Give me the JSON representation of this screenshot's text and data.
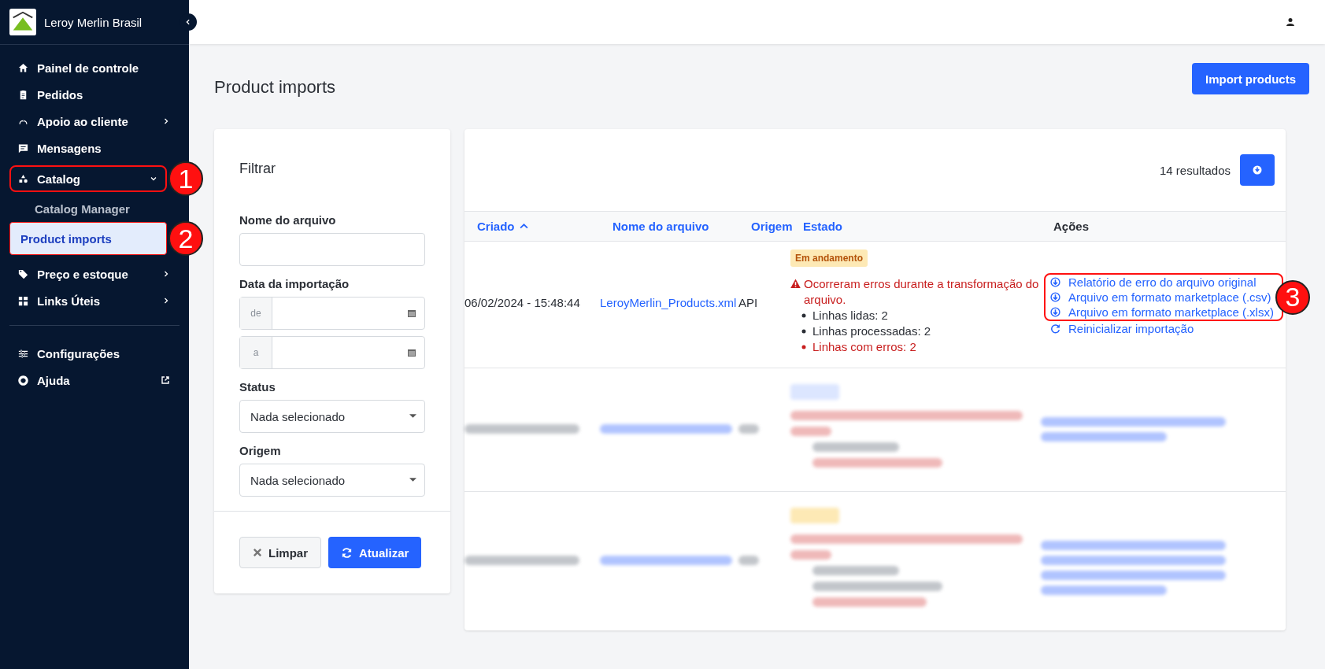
{
  "sidebar": {
    "brand": "Leroy Merlin Brasil",
    "sections": [
      [
        {
          "label": "Painel de controle"
        },
        {
          "label": "Pedidos"
        },
        {
          "label": "Apoio ao cliente",
          "expanded": false
        },
        {
          "label": "Mensagens"
        },
        {
          "label": "Catalog",
          "expanded": true,
          "callout": "1",
          "children": [
            {
              "label": "Catalog Manager",
              "selected": false
            },
            {
              "label": "Product imports",
              "selected": true,
              "callout": "2"
            }
          ]
        },
        {
          "label": "Preço e estoque",
          "expanded": false
        },
        {
          "label": "Links Úteis",
          "expanded": false
        }
      ],
      [
        {
          "label": "Configurações"
        },
        {
          "label": "Ajuda",
          "external": true
        }
      ]
    ]
  },
  "page": {
    "title": "Product imports",
    "import_button": "Import products"
  },
  "filter": {
    "title": "Filtrar",
    "file_label": "Nome do arquivo",
    "date_label": "Data da importação",
    "date_from": "de",
    "date_to": "a",
    "status_label": "Status",
    "status_value": "Nada selecionado",
    "origin_label": "Origem",
    "origin_value": "Nada selecionado",
    "clear_button": "Limpar",
    "refresh_button": "Atualizar"
  },
  "table": {
    "results": "14 resultados",
    "columns": [
      {
        "label": "Criado",
        "sorted": true,
        "link": true
      },
      {
        "label": "Nome do arquivo",
        "link": true
      },
      {
        "label": "Origem",
        "link": true
      },
      {
        "label": "Estado",
        "link": true
      },
      {
        "label": "Ações",
        "link": false
      }
    ],
    "rows": [
      {
        "blurred": false,
        "created": "06/02/2024 - 15:48:44",
        "file": "LeroyMerlin_Products.xml",
        "origin": "API",
        "status": {
          "label": "Em andamento",
          "kind": "progress"
        },
        "error": "Ocorreram erros durante a transformação do arquivo.",
        "lines": [
          {
            "text": "Linhas lidas: 2",
            "error": false
          },
          {
            "text": "Linhas processadas: 2",
            "error": false
          },
          {
            "text": "Linhas com erros: 2",
            "error": true
          }
        ],
        "callout": "3",
        "actions": [
          {
            "kind": "download",
            "label": "Relatório de erro do arquivo original",
            "in_callout": true
          },
          {
            "kind": "download",
            "label": "Arquivo em formato marketplace (.csv)",
            "in_callout": true
          },
          {
            "kind": "download",
            "label": "Arquivo em formato marketplace (.xlsx)",
            "in_callout": true
          },
          {
            "kind": "restart",
            "label": "Reinicializar importação",
            "in_callout": false
          }
        ]
      },
      {
        "blurred": true,
        "status": {
          "kind": "done"
        },
        "lines": [
          {
            "error": false
          },
          {
            "error": true
          }
        ],
        "actions": [
          {
            "kind": "download"
          },
          {
            "kind": "restart"
          }
        ]
      },
      {
        "blurred": true,
        "status": {
          "kind": "progress"
        },
        "lines": [
          {
            "error": false
          },
          {
            "error": false
          },
          {
            "error": true
          }
        ],
        "actions": [
          {
            "kind": "download"
          },
          {
            "kind": "download"
          },
          {
            "kind": "download"
          },
          {
            "kind": "restart"
          }
        ]
      }
    ]
  }
}
